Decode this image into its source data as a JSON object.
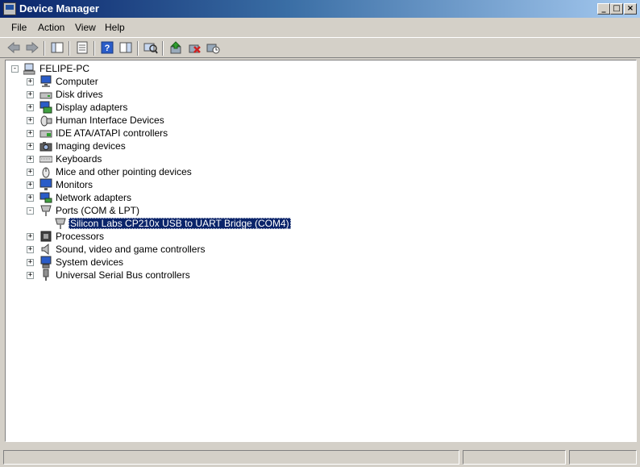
{
  "window": {
    "title": "Device Manager",
    "controls": [
      "_",
      "□",
      "×"
    ]
  },
  "menu": [
    "File",
    "Action",
    "View",
    "Help"
  ],
  "toolbar": [
    "back-icon",
    "forward-icon",
    "show-hide-console-tree-icon",
    "properties-icon",
    "help-icon",
    "action-pane-icon",
    "scan-hardware-icon",
    "update-driver-icon",
    "uninstall-icon",
    "disable-icon"
  ],
  "tree": {
    "root": {
      "label": "FELIPE-PC",
      "expander": "-"
    },
    "items": [
      {
        "label": "Computer",
        "expander": "+"
      },
      {
        "label": "Disk drives",
        "expander": "+"
      },
      {
        "label": "Display adapters",
        "expander": "+"
      },
      {
        "label": "Human Interface Devices",
        "expander": "+"
      },
      {
        "label": "IDE ATA/ATAPI controllers",
        "expander": "+"
      },
      {
        "label": "Imaging devices",
        "expander": "+"
      },
      {
        "label": "Keyboards",
        "expander": "+"
      },
      {
        "label": "Mice and other pointing devices",
        "expander": "+"
      },
      {
        "label": "Monitors",
        "expander": "+"
      },
      {
        "label": "Network adapters",
        "expander": "+"
      },
      {
        "label": "Ports (COM & LPT)",
        "expander": "-"
      },
      {
        "label": "Silicon Labs CP210x USB to UART Bridge (COM4)",
        "selected": true
      },
      {
        "label": "Processors",
        "expander": "+"
      },
      {
        "label": "Sound, video and game controllers",
        "expander": "+"
      },
      {
        "label": "System devices",
        "expander": "+"
      },
      {
        "label": "Universal Serial Bus controllers",
        "expander": "+"
      }
    ]
  }
}
